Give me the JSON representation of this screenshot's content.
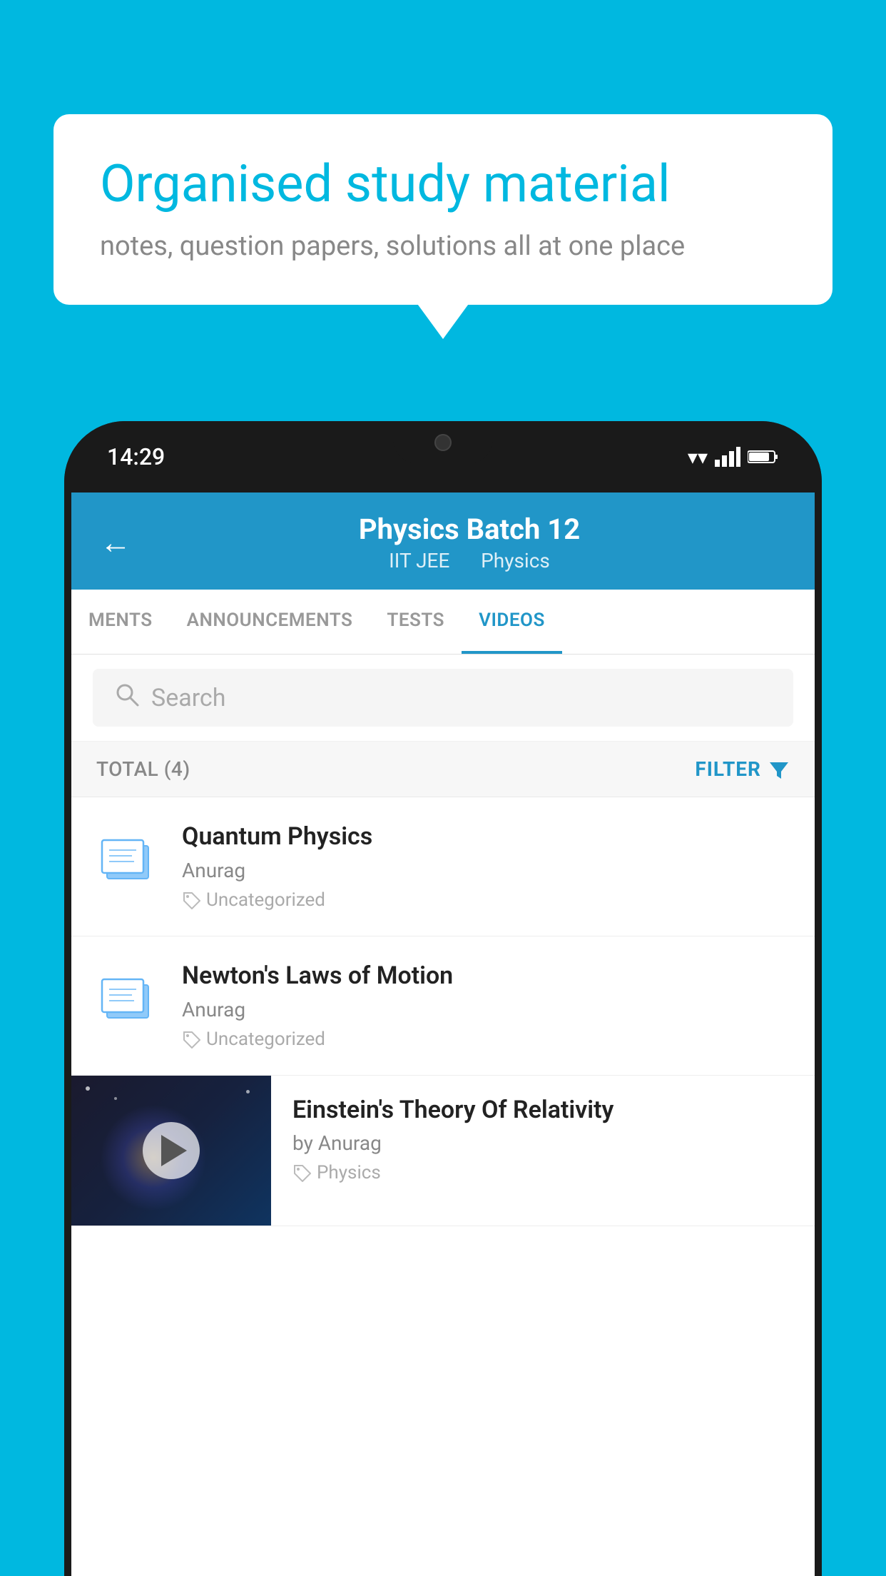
{
  "background_color": "#00b8e0",
  "speech_bubble": {
    "title": "Organised study material",
    "subtitle": "notes, question papers, solutions all at one place"
  },
  "phone": {
    "time": "14:29",
    "header": {
      "title": "Physics Batch 12",
      "subtitle_part1": "IIT JEE",
      "subtitle_part2": "Physics"
    },
    "tabs": [
      {
        "label": "MENTS",
        "active": false
      },
      {
        "label": "ANNOUNCEMENTS",
        "active": false
      },
      {
        "label": "TESTS",
        "active": false
      },
      {
        "label": "VIDEOS",
        "active": true
      }
    ],
    "search": {
      "placeholder": "Search"
    },
    "filter": {
      "total_label": "TOTAL (4)",
      "filter_label": "FILTER"
    },
    "videos": [
      {
        "title": "Quantum Physics",
        "author": "Anurag",
        "tag": "Uncategorized",
        "has_thumbnail": false
      },
      {
        "title": "Newton's Laws of Motion",
        "author": "Anurag",
        "tag": "Uncategorized",
        "has_thumbnail": false
      },
      {
        "title": "Einstein's Theory Of Relativity",
        "author": "by Anurag",
        "tag": "Physics",
        "has_thumbnail": true
      }
    ]
  }
}
